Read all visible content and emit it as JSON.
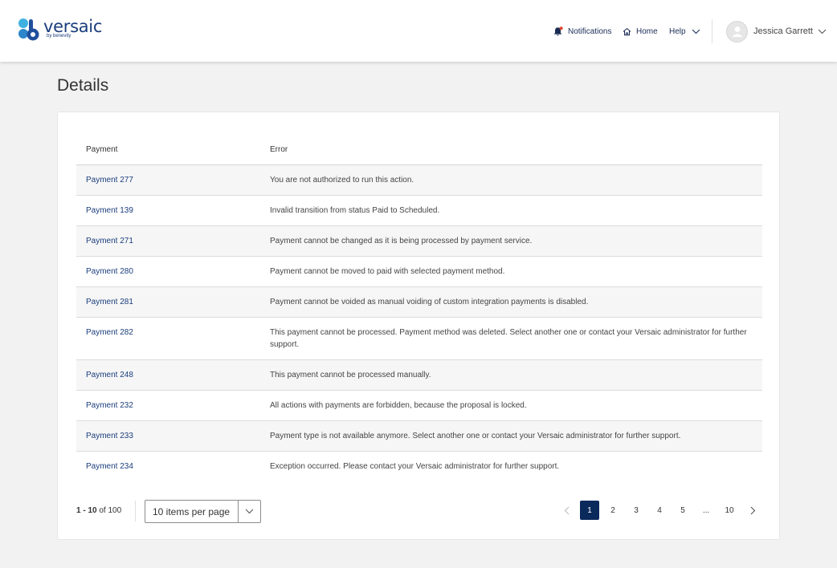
{
  "header": {
    "logo_word": "versaic",
    "logo_sub": "by benevity",
    "notifications_label": "Notifications",
    "home_label": "Home",
    "help_label": "Help",
    "user_name": "Jessica Garrett"
  },
  "page": {
    "title": "Details"
  },
  "table": {
    "columns": [
      "Payment",
      "Error"
    ],
    "rows": [
      {
        "payment": "Payment 277",
        "error": "You are not authorized to run this action."
      },
      {
        "payment": "Payment 139",
        "error": "Invalid transition from status Paid to Scheduled."
      },
      {
        "payment": "Payment 271",
        "error": "Payment cannot be changed as it is being processed by payment service."
      },
      {
        "payment": "Payment 280",
        "error": "Payment cannot be moved to paid with selected payment method."
      },
      {
        "payment": "Payment 281",
        "error": "Payment cannot be voided as manual voiding of custom integration payments is disabled."
      },
      {
        "payment": "Payment 282",
        "error": "This payment cannot be processed. Payment method was deleted. Select another one or contact your Versaic administrator for further support."
      },
      {
        "payment": "Payment 248",
        "error": "This payment cannot be processed manually."
      },
      {
        "payment": "Payment 232",
        "error": "All actions with payments are forbidden, because the proposal is locked."
      },
      {
        "payment": "Payment 233",
        "error": "Payment type is not available anymore. Select another one or contact your Versaic administrator for further support."
      },
      {
        "payment": "Payment 234",
        "error": "Exception occurred. Please contact your Versaic administrator for further support."
      }
    ]
  },
  "pagination": {
    "range": "1 - 10",
    "of_label": "of",
    "total": "100",
    "per_page": "10 items per page",
    "pages": [
      "1",
      "2",
      "3",
      "4",
      "5",
      "...",
      "10"
    ],
    "current": "1"
  },
  "colors": {
    "brand": "#1a3d7c",
    "active_page": "#0b2a5c",
    "logo_blue": "#1f6fb4",
    "logo_teal": "#3fb1e0"
  }
}
